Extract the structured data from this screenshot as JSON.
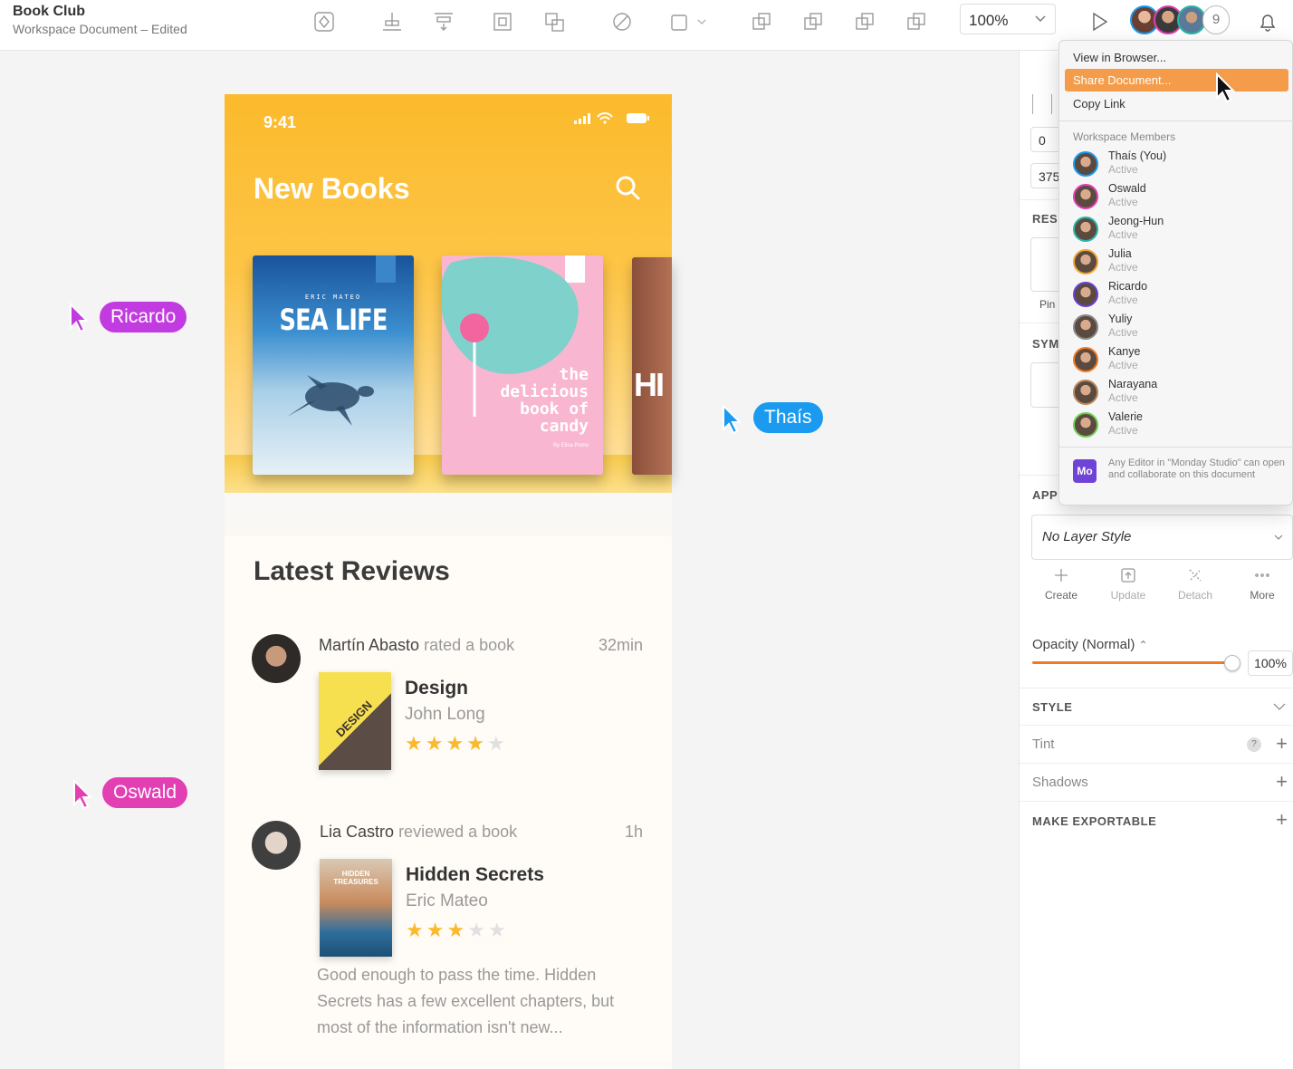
{
  "toolbar": {
    "doc_title": "Book Club",
    "doc_subtitle": "Workspace Document – Edited",
    "zoom": "100%",
    "member_count": "9"
  },
  "app": {
    "time": "9:41",
    "title": "New Books",
    "books": [
      {
        "series_label": "ERIC MATEO",
        "title": "SEA LIFE"
      },
      {
        "title_lines": [
          "the",
          "delicious",
          "book of",
          "candy"
        ],
        "byline": "By Elisa Pomo"
      },
      {
        "letters": "HI"
      }
    ]
  },
  "reviews": {
    "title": "Latest Reviews",
    "items": [
      {
        "user": "Martín Abasto",
        "action": "rated a book",
        "time": "32min",
        "cover_text": "DESIGN",
        "book": "Design",
        "author": "John Long",
        "rating": 4,
        "text": ""
      },
      {
        "user": "Lia Castro",
        "action": "reviewed a book",
        "time": "1h",
        "cover_text": "HIDDEN TREASURES",
        "book": "Hidden Secrets",
        "author": "Eric Mateo",
        "rating": 3,
        "text": "Good enough to pass the time. Hidden Secrets has a few excellent chapters, but most of the information isn't new..."
      }
    ]
  },
  "collaborators": [
    {
      "name": "Ricardo",
      "color": "#c23be0"
    },
    {
      "name": "Thaís",
      "color": "#1a9bf0"
    },
    {
      "name": "Oswald",
      "color": "#e23fb3"
    }
  ],
  "inspector": {
    "field_a": "0",
    "field_b": "375",
    "resizing_label": "RESI",
    "pin_label": "Pin",
    "symbol_label": "SYM",
    "appearance_label": "APPE",
    "layer_style": "No Layer Style",
    "actions": [
      "Create",
      "Update",
      "Detach",
      "More"
    ],
    "opacity_label": "Opacity (Normal)",
    "opacity_value": "100%",
    "opacity": 1.0,
    "style_label": "STYLE",
    "tint_label": "Tint",
    "shadows_label": "Shadows",
    "export_label": "MAKE EXPORTABLE",
    "accent_color": "#f07a23"
  },
  "dropdown": {
    "items": [
      "View in Browser...",
      "Share Document...",
      "Copy Link"
    ],
    "members_header": "Workspace Members",
    "members": [
      {
        "name": "Thaís (You)",
        "status": "Active",
        "color": "#1a9bf0"
      },
      {
        "name": "Oswald",
        "status": "Active",
        "color": "#e23fb3"
      },
      {
        "name": "Jeong-Hun",
        "status": "Active",
        "color": "#29b6a8"
      },
      {
        "name": "Julia",
        "status": "Active",
        "color": "#f0a530"
      },
      {
        "name": "Ricardo",
        "status": "Active",
        "color": "#6a3fd6"
      },
      {
        "name": "Yuliy",
        "status": "Active",
        "color": "#888888"
      },
      {
        "name": "Kanye",
        "status": "Active",
        "color": "#f07a23"
      },
      {
        "name": "Narayana",
        "status": "Active",
        "color": "#b9875a"
      },
      {
        "name": "Valerie",
        "status": "Active",
        "color": "#6fcf54"
      }
    ],
    "studio_badge": "Mo",
    "studio_note": "Any Editor in \"Monday Studio\" can open and collaborate on this document"
  }
}
